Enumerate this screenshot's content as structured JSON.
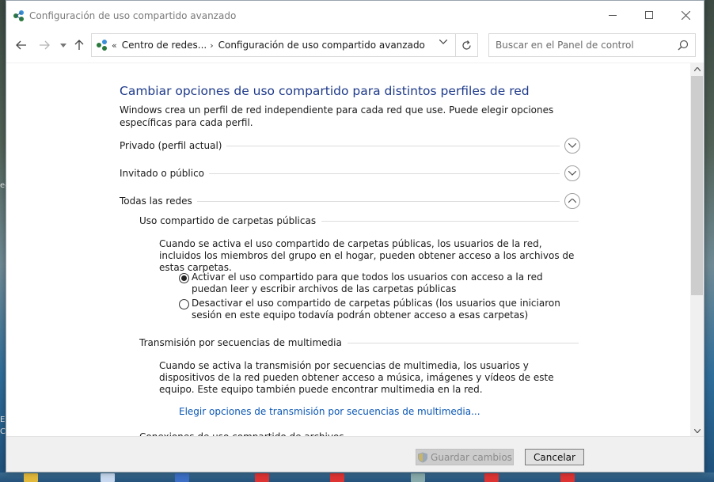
{
  "window": {
    "title": "Configuración de uso compartido avanzado"
  },
  "navigation": {
    "back_icon": "arrow-left-icon",
    "forward_icon": "arrow-right-icon",
    "up_icon": "arrow-up-icon",
    "breadcrumb_overflow": "«",
    "breadcrumb": [
      "Centro de redes...",
      "Configuración de uso compartido avanzado"
    ],
    "search_placeholder": "Buscar en el Panel de control"
  },
  "main": {
    "heading": "Cambiar opciones de uso compartido para distintos perfiles de red",
    "intro": "Windows crea un perfil de red independiente para cada red que use. Puede elegir opciones específicas para cada perfil.",
    "profiles": [
      {
        "label": "Privado (perfil actual)",
        "expanded": false
      },
      {
        "label": "Invitado o público",
        "expanded": false
      },
      {
        "label": "Todas las redes",
        "expanded": true
      }
    ],
    "public_folders": {
      "heading": "Uso compartido de carpetas públicas",
      "description": "Cuando se activa el uso compartido de carpetas públicas, los usuarios de la red, incluidos los miembros del grupo en el hogar, pueden obtener acceso a los archivos de estas carpetas.",
      "options": [
        {
          "label": "Activar el uso compartido para que todos los usuarios con acceso a la red puedan leer y escribir archivos de las carpetas públicas",
          "selected": true
        },
        {
          "label": "Desactivar el uso compartido de carpetas públicas (los usuarios que iniciaron sesión en este equipo todavía podrán obtener acceso a esas carpetas)",
          "selected": false
        }
      ]
    },
    "media_streaming": {
      "heading": "Transmisión por secuencias de multimedia",
      "description": "Cuando se activa la transmisión por secuencias de multimedia, los usuarios y dispositivos de la red pueden obtener acceso a música, imágenes y vídeos de este equipo. Este equipo también puede encontrar multimedia en la red.",
      "link": "Elegir opciones de transmisión por secuencias de multimedia..."
    },
    "file_sharing": {
      "heading": "Conexiones de uso compartido de archivos"
    }
  },
  "footer": {
    "save_label": "Guardar cambios",
    "save_enabled": false,
    "cancel_label": "Cancelar"
  },
  "colors": {
    "heading_blue": "#1e3a8a",
    "link_blue": "#0b57b5",
    "footer_bg": "#f0f0f0"
  }
}
